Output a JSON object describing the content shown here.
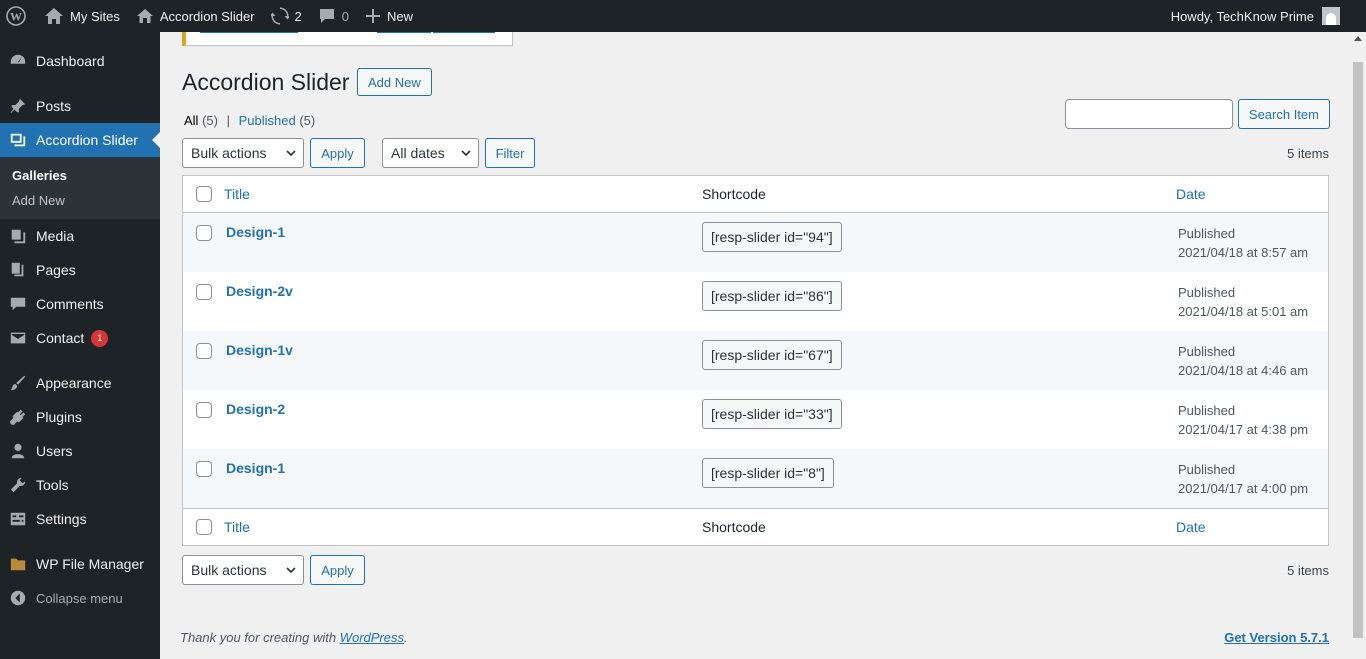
{
  "adminbar": {
    "my_sites": "My Sites",
    "site_name": "Accordion Slider",
    "updates_count": "2",
    "comments_count": "0",
    "new_label": "New",
    "greeting": "Howdy, TechKnow Prime"
  },
  "sidebar": {
    "items": [
      {
        "label": "Dashboard",
        "icon": "dashboard-icon"
      },
      {
        "label": "Posts",
        "icon": "pin-icon"
      },
      {
        "label": "Accordion Slider",
        "icon": "slides-icon"
      },
      {
        "label": "Media",
        "icon": "media-icon"
      },
      {
        "label": "Pages",
        "icon": "pages-icon"
      },
      {
        "label": "Comments",
        "icon": "comment-icon"
      },
      {
        "label": "Contact",
        "icon": "mail-icon",
        "badge": "1"
      },
      {
        "label": "Appearance",
        "icon": "brush-icon"
      },
      {
        "label": "Plugins",
        "icon": "plugin-icon"
      },
      {
        "label": "Users",
        "icon": "user-icon"
      },
      {
        "label": "Tools",
        "icon": "wrench-icon"
      },
      {
        "label": "Settings",
        "icon": "settings-icon"
      },
      {
        "label": "WP File Manager",
        "icon": "folder-icon"
      }
    ],
    "submenu": [
      "Galleries",
      "Add New"
    ],
    "collapse_label": "Collapse menu"
  },
  "page": {
    "title": "Accordion Slider",
    "add_new": "Add New",
    "filters": {
      "all_label": "All",
      "all_count": "(5)",
      "separator": "|",
      "published_label": "Published",
      "published_count": "(5)"
    },
    "search_button": "Search Item",
    "bulk_actions": "Bulk actions",
    "apply": "Apply",
    "all_dates": "All dates",
    "filter": "Filter",
    "items_count": "5 items"
  },
  "table": {
    "columns": {
      "title": "Title",
      "shortcode": "Shortcode",
      "date": "Date"
    },
    "rows": [
      {
        "title": "Design-1",
        "shortcode": "[resp-slider id=\"94\"]",
        "status": "Published",
        "date": "2021/04/18 at 8:57 am"
      },
      {
        "title": "Design-2v",
        "shortcode": "[resp-slider id=\"86\"]",
        "status": "Published",
        "date": "2021/04/18 at 5:01 am"
      },
      {
        "title": "Design-1v",
        "shortcode": "[resp-slider id=\"67\"]",
        "status": "Published",
        "date": "2021/04/18 at 4:46 am"
      },
      {
        "title": "Design-2",
        "shortcode": "[resp-slider id=\"33\"]",
        "status": "Published",
        "date": "2021/04/17 at 4:38 pm"
      },
      {
        "title": "Design-1",
        "shortcode": "[resp-slider id=\"8\"]",
        "status": "Published",
        "date": "2021/04/17 at 4:00 pm"
      }
    ]
  },
  "footer": {
    "thanks_prefix": "Thank you for creating with ",
    "wordpress_link": "WordPress",
    "thanks_suffix": ".",
    "version": "Get Version 5.7.1"
  },
  "colors": {
    "accent": "#2271b1",
    "adminbar": "#1d2327",
    "badge": "#d63638"
  }
}
